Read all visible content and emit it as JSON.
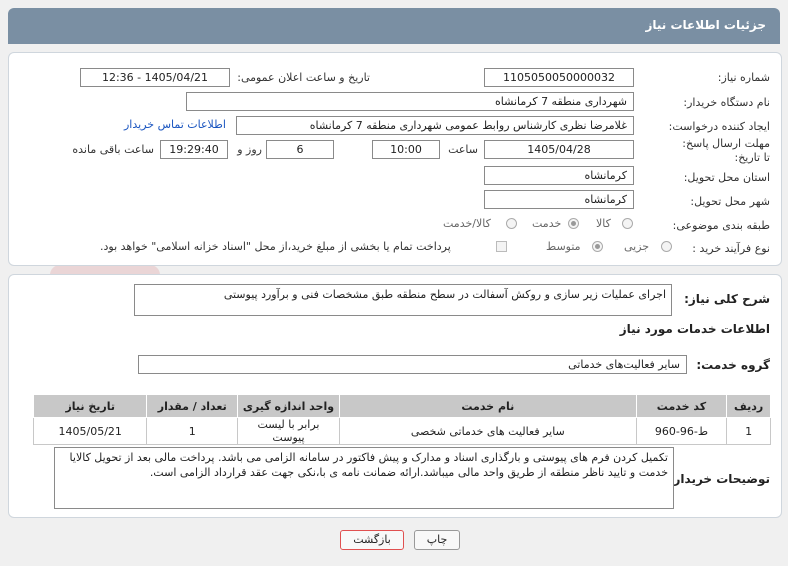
{
  "header": {
    "title": "جزئیات اطلاعات نیاز"
  },
  "form": {
    "need_number": {
      "label": "شماره نیاز:",
      "value": "1105050050000032"
    },
    "announce": {
      "label": "تاریخ و ساعت اعلان عمومی:",
      "value": "1405/04/21 - 12:36"
    },
    "buyer_org": {
      "label": "نام دستگاه خریدار:",
      "value": "شهرداری منطقه 7 کرمانشاه"
    },
    "creator": {
      "label": "ایجاد کننده درخواست:",
      "value": "غلامرضا نظری کارشناس روابط عمومی شهرداری منطقه 7 کرمانشاه",
      "contact_link": "اطلاعات تماس خریدار"
    },
    "deadline": {
      "label": "مهلت ارسال پاسخ: تا تاریخ:",
      "date": "1405/04/28",
      "time_label": "ساعت",
      "time": "10:00",
      "days": "6",
      "days_label": "روز و",
      "remaining": "19:29:40",
      "remaining_label": "ساعت باقی مانده"
    },
    "province": {
      "label": "استان محل تحویل:",
      "value": "کرمانشاه"
    },
    "city": {
      "label": "شهر محل تحویل:",
      "value": "کرمانشاه"
    },
    "category": {
      "label": "طبقه بندی موضوعی:",
      "options": [
        "کالا",
        "خدمت",
        "کالا/خدمت"
      ],
      "selected": "خدمت"
    },
    "purchase_type": {
      "label": "نوع فرآیند خرید :",
      "options": [
        "جزیی",
        "متوسط"
      ],
      "selected": "متوسط",
      "payment_note": "پرداخت تمام یا بخشی از مبلغ خرید،از محل \"اسناد خزانه اسلامی\" خواهد بود."
    }
  },
  "description": {
    "label": "شرح کلی نیاز:",
    "value": "اجرای عملیات زیر سازی و روکش آسفالت در سطح منطقه طبق مشخصات فنی و برآورد پیوستی"
  },
  "services_title": "اطلاعات خدمات مورد نیاز",
  "service_group": {
    "label": "گروه خدمت:",
    "value": "سایر فعالیت‌های خدماتی"
  },
  "table": {
    "headers": [
      "ردیف",
      "کد خدمت",
      "نام خدمت",
      "واحد اندازه گیری",
      "تعداد / مقدار",
      "تاریخ نیاز"
    ],
    "rows": [
      [
        "1",
        "ط-96-960",
        "سایر فعالیت های خدماتی شخصی",
        "برابر با لیست پیوست",
        "1",
        "1405/05/21"
      ]
    ]
  },
  "buyer_notes": {
    "label": "توضیحات خریدار:",
    "value": "تکمیل کردن فرم های پیوستی و بارگذاری اسناد و مدارک و پیش فاکتور در سامانه الزامی می باشد. پرداخت مالی بعد از تحویل کالایا خدمت و تایید ناظر منطقه از طریق واحد مالی میباشد.ارائه ضمانت نامه ی با،نکی جهت عقد قرارداد الزامی است."
  },
  "buttons": {
    "print": "چاپ",
    "back": "بازگشت"
  },
  "watermark": {
    "text": "AriaTender.net"
  },
  "colors": {
    "header_bg": "#7a8fa3",
    "link": "#1a55c0",
    "back_button_border": "#e05050"
  }
}
